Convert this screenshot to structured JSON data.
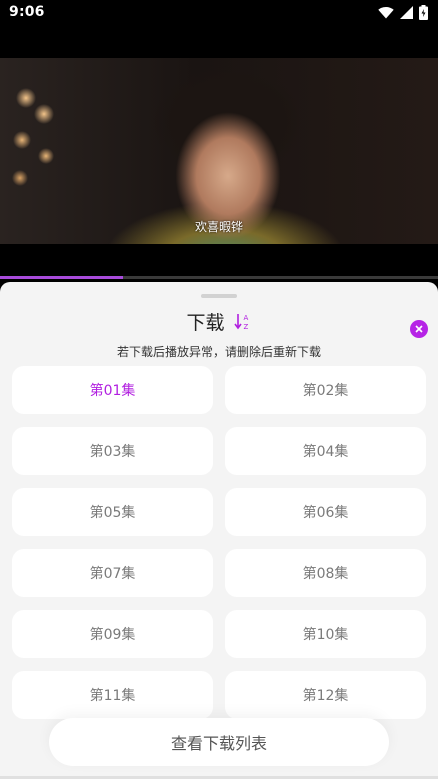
{
  "status_bar": {
    "time": "9:06",
    "icons": [
      "wifi-icon",
      "signal-icon",
      "battery-icon"
    ]
  },
  "video": {
    "subtitle": "欢喜暇铧",
    "progress": 0.28
  },
  "sheet": {
    "title": "下载",
    "sort_icon_text": "A↓Z",
    "hint": "若下载后播放异常，请删除后重新下载",
    "episodes": [
      {
        "label": "第01集",
        "selected": true
      },
      {
        "label": "第02集",
        "selected": false
      },
      {
        "label": "第03集",
        "selected": false
      },
      {
        "label": "第04集",
        "selected": false
      },
      {
        "label": "第05集",
        "selected": false
      },
      {
        "label": "第06集",
        "selected": false
      },
      {
        "label": "第07集",
        "selected": false
      },
      {
        "label": "第08集",
        "selected": false
      },
      {
        "label": "第09集",
        "selected": false
      },
      {
        "label": "第10集",
        "selected": false
      },
      {
        "label": "第11集",
        "selected": false
      },
      {
        "label": "第12集",
        "selected": false
      }
    ],
    "view_list_label": "查看下载列表"
  },
  "colors": {
    "accent": "#b11fe0",
    "close": "#b624e6",
    "sheet_bg": "#f4f4f4"
  }
}
